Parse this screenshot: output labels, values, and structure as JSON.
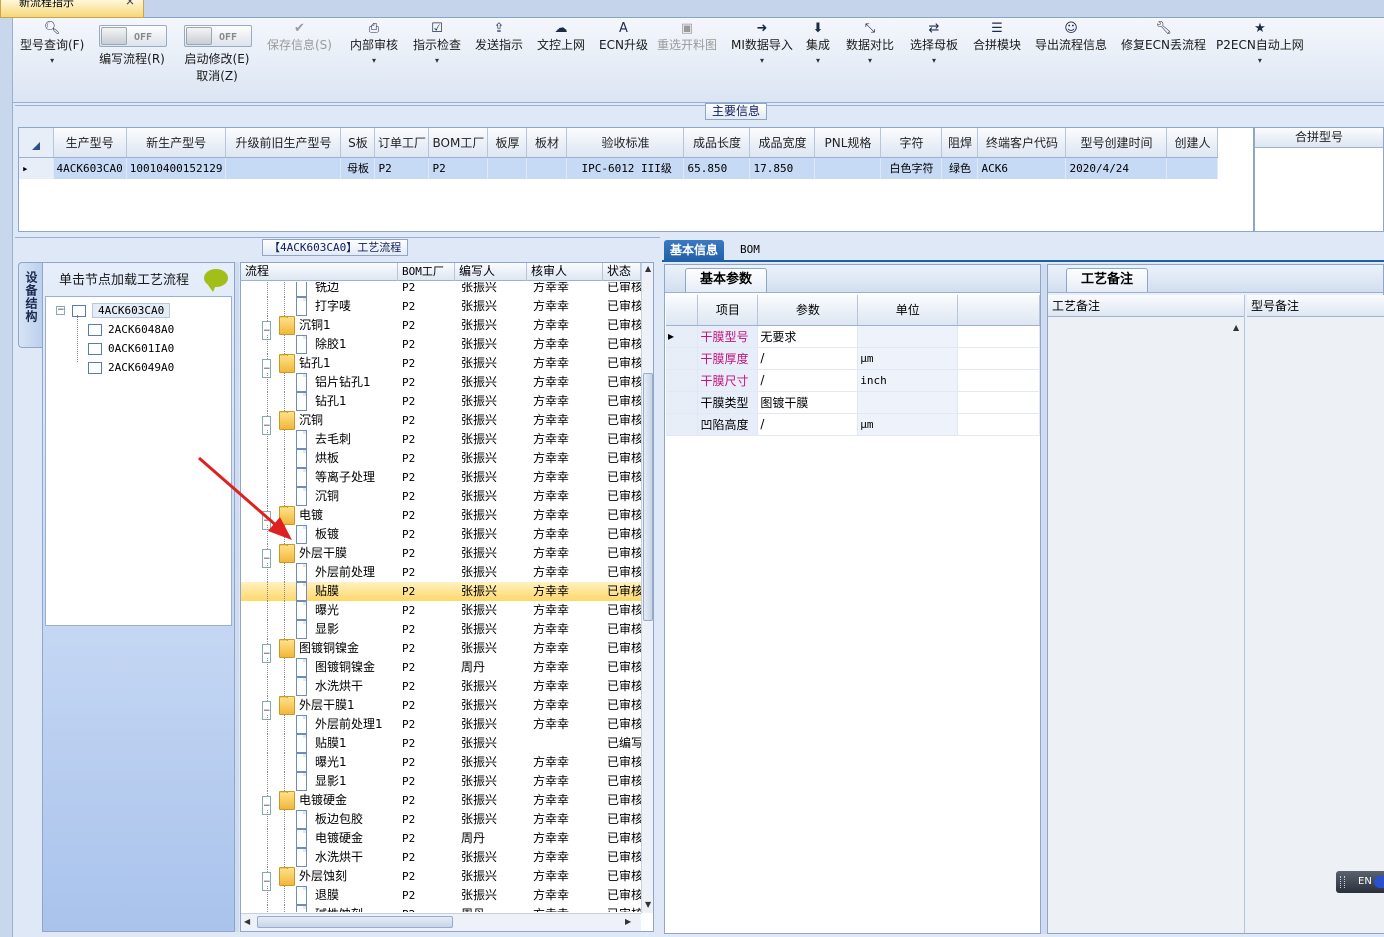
{
  "doc_tab": {
    "label": "新流程指示",
    "close": "×"
  },
  "toolbar": {
    "buttons": [
      {
        "label": "型号查询(F)",
        "icon": "search-icon"
      },
      {
        "label": "编写流程(R)",
        "toggle": "OFF"
      },
      {
        "label": "启动修改(E)",
        "label2": "取消(Z)",
        "toggle": "OFF"
      },
      {
        "label": "保存信息(S)",
        "icon": "check-icon"
      },
      {
        "label": "内部审核",
        "icon": "printer-icon"
      },
      {
        "label": "指示检查",
        "icon": "checkbox-icon"
      },
      {
        "label": "发送指示",
        "icon": "upload-icon"
      },
      {
        "label": "文控上网",
        "icon": "cloud-upload-icon"
      },
      {
        "label": "ECN升级",
        "icon": "font-icon"
      },
      {
        "label": "重选开料图",
        "icon": "image-icon"
      },
      {
        "label": "MI数据导入",
        "icon": "import-icon"
      },
      {
        "label": "集成",
        "icon": "download-icon"
      },
      {
        "label": "数据对比",
        "icon": "compress-icon"
      },
      {
        "label": "选择母板",
        "icon": "shuffle-icon"
      },
      {
        "label": "合拼模块",
        "icon": "list-icon"
      },
      {
        "label": "导出流程信息",
        "icon": "smile-icon"
      },
      {
        "label": "修复ECN丢流程",
        "icon": "wrench-icon"
      },
      {
        "label": "P2ECN自动上网",
        "icon": "star-icon"
      }
    ],
    "dropdown_arrow": "▾"
  },
  "main_info": {
    "caption": "主要信息",
    "columns": [
      "生产型号",
      "新生产型号",
      "升级前旧生产型号",
      "S板",
      "订单工厂",
      "BOM工厂",
      "板厚",
      "板材",
      "验收标准",
      "成品长度",
      "成品宽度",
      "PNL规格",
      "字符",
      "阻焊",
      "终端客户代码",
      "型号创建时间",
      "创建人"
    ],
    "row": [
      "4ACK603CA0",
      "10010400152129",
      "",
      "母板",
      "P2",
      "P2",
      "",
      "",
      "IPC-6012 III级",
      "65.850",
      "17.850",
      "",
      "白色字符",
      "绿色",
      "ACK6",
      "2020/4/24",
      ""
    ],
    "side_column": "合拼型号"
  },
  "process_caption": "【4ACK603CA0】工艺流程",
  "left_panel": {
    "tab": "设备结构",
    "header": "单击节点加载工艺流程",
    "tree": [
      "4ACK603CA0",
      "2ACK6048A0",
      "0ACK601IA0",
      "2ACK6049A0"
    ]
  },
  "flow_grid": {
    "columns": [
      "流程",
      "BOM工厂",
      "编写人",
      "核审人",
      "状态"
    ],
    "rows": [
      {
        "name": "铣边",
        "lvl": 2,
        "bom": "P2",
        "w": "张振兴",
        "r": "方幸幸",
        "s": "已审核"
      },
      {
        "name": "打字唛",
        "lvl": 2,
        "bom": "P2",
        "w": "张振兴",
        "r": "方幸幸",
        "s": "已审核"
      },
      {
        "name": "沉铜1",
        "lvl": 1,
        "bom": "P2",
        "w": "张振兴",
        "r": "方幸幸",
        "s": "已审核"
      },
      {
        "name": "除胶1",
        "lvl": 2,
        "bom": "P2",
        "w": "张振兴",
        "r": "方幸幸",
        "s": "已审核"
      },
      {
        "name": "钻孔1",
        "lvl": 1,
        "bom": "P2",
        "w": "张振兴",
        "r": "方幸幸",
        "s": "已审核"
      },
      {
        "name": "铝片钻孔1",
        "lvl": 2,
        "bom": "P2",
        "w": "张振兴",
        "r": "方幸幸",
        "s": "已审核"
      },
      {
        "name": "钻孔1",
        "lvl": 2,
        "bom": "P2",
        "w": "张振兴",
        "r": "方幸幸",
        "s": "已审核"
      },
      {
        "name": "沉铜",
        "lvl": 1,
        "bom": "P2",
        "w": "张振兴",
        "r": "方幸幸",
        "s": "已审核"
      },
      {
        "name": "去毛刺",
        "lvl": 2,
        "bom": "P2",
        "w": "张振兴",
        "r": "方幸幸",
        "s": "已审核"
      },
      {
        "name": "烘板",
        "lvl": 2,
        "bom": "P2",
        "w": "张振兴",
        "r": "方幸幸",
        "s": "已审核"
      },
      {
        "name": "等离子处理",
        "lvl": 2,
        "bom": "P2",
        "w": "张振兴",
        "r": "方幸幸",
        "s": "已审核"
      },
      {
        "name": "沉铜",
        "lvl": 2,
        "bom": "P2",
        "w": "张振兴",
        "r": "方幸幸",
        "s": "已审核"
      },
      {
        "name": "电镀",
        "lvl": 1,
        "bom": "P2",
        "w": "张振兴",
        "r": "方幸幸",
        "s": "已审核"
      },
      {
        "name": "板镀",
        "lvl": 2,
        "bom": "P2",
        "w": "张振兴",
        "r": "方幸幸",
        "s": "已审核"
      },
      {
        "name": "外层干膜",
        "lvl": 1,
        "bom": "P2",
        "w": "张振兴",
        "r": "方幸幸",
        "s": "已审核"
      },
      {
        "name": "外层前处理",
        "lvl": 2,
        "bom": "P2",
        "w": "张振兴",
        "r": "方幸幸",
        "s": "已审核"
      },
      {
        "name": "贴膜",
        "lvl": 2,
        "bom": "P2",
        "w": "张振兴",
        "r": "方幸幸",
        "s": "已审核",
        "selected": true
      },
      {
        "name": "曝光",
        "lvl": 2,
        "bom": "P2",
        "w": "张振兴",
        "r": "方幸幸",
        "s": "已审核"
      },
      {
        "name": "显影",
        "lvl": 2,
        "bom": "P2",
        "w": "张振兴",
        "r": "方幸幸",
        "s": "已审核"
      },
      {
        "name": "图镀铜镍金",
        "lvl": 1,
        "bom": "P2",
        "w": "张振兴",
        "r": "方幸幸",
        "s": "已审核"
      },
      {
        "name": "图镀铜镍金",
        "lvl": 2,
        "bom": "P2",
        "w": "周丹",
        "r": "方幸幸",
        "s": "已审核"
      },
      {
        "name": "水洗烘干",
        "lvl": 2,
        "bom": "P2",
        "w": "张振兴",
        "r": "方幸幸",
        "s": "已审核"
      },
      {
        "name": "外层干膜1",
        "lvl": 1,
        "bom": "P2",
        "w": "张振兴",
        "r": "方幸幸",
        "s": "已审核"
      },
      {
        "name": "外层前处理1",
        "lvl": 2,
        "bom": "P2",
        "w": "张振兴",
        "r": "方幸幸",
        "s": "已审核"
      },
      {
        "name": "贴膜1",
        "lvl": 2,
        "bom": "P2",
        "w": "张振兴",
        "r": "",
        "s": "已编写"
      },
      {
        "name": "曝光1",
        "lvl": 2,
        "bom": "P2",
        "w": "张振兴",
        "r": "方幸幸",
        "s": "已审核"
      },
      {
        "name": "显影1",
        "lvl": 2,
        "bom": "P2",
        "w": "张振兴",
        "r": "方幸幸",
        "s": "已审核"
      },
      {
        "name": "电镀硬金",
        "lvl": 1,
        "bom": "P2",
        "w": "张振兴",
        "r": "方幸幸",
        "s": "已审核"
      },
      {
        "name": "板边包胶",
        "lvl": 2,
        "bom": "P2",
        "w": "张振兴",
        "r": "方幸幸",
        "s": "已审核"
      },
      {
        "name": "电镀硬金",
        "lvl": 2,
        "bom": "P2",
        "w": "周丹",
        "r": "方幸幸",
        "s": "已审核"
      },
      {
        "name": "水洗烘干",
        "lvl": 2,
        "bom": "P2",
        "w": "张振兴",
        "r": "方幸幸",
        "s": "已审核"
      },
      {
        "name": "外层蚀刻",
        "lvl": 1,
        "bom": "P2",
        "w": "张振兴",
        "r": "方幸幸",
        "s": "已审核"
      },
      {
        "name": "退膜",
        "lvl": 2,
        "bom": "P2",
        "w": "张振兴",
        "r": "方幸幸",
        "s": "已审核"
      },
      {
        "name": "碱性蚀刻",
        "lvl": 2,
        "bom": "P2",
        "w": "周丹",
        "r": "方幸幸",
        "s": "已审核"
      }
    ]
  },
  "info_tabs": [
    "基本信息",
    "BOM"
  ],
  "basic_params": {
    "tab": "基本参数",
    "columns": [
      "项目",
      "参数",
      "单位"
    ],
    "rows": [
      {
        "item": "干膜型号",
        "param": "无要求",
        "unit": "",
        "hl": true
      },
      {
        "item": "干膜厚度",
        "param": "/",
        "unit": "μm",
        "hl": true
      },
      {
        "item": "干膜尺寸",
        "param": "/",
        "unit": "inch",
        "hl": true
      },
      {
        "item": "干膜类型",
        "param": "图镀干膜",
        "unit": "",
        "hl": false
      },
      {
        "item": "凹陷高度",
        "param": "/",
        "unit": "μm",
        "hl": false
      }
    ]
  },
  "remarks": {
    "tab": "工艺备注",
    "col1": "工艺备注",
    "col2": "型号备注"
  },
  "ime": {
    "label": "EN"
  },
  "colors": {
    "selection": "#ffd86a",
    "accent": "#1f5fa8",
    "highlight_text": "#c0147a",
    "arrow": "#e02020"
  }
}
